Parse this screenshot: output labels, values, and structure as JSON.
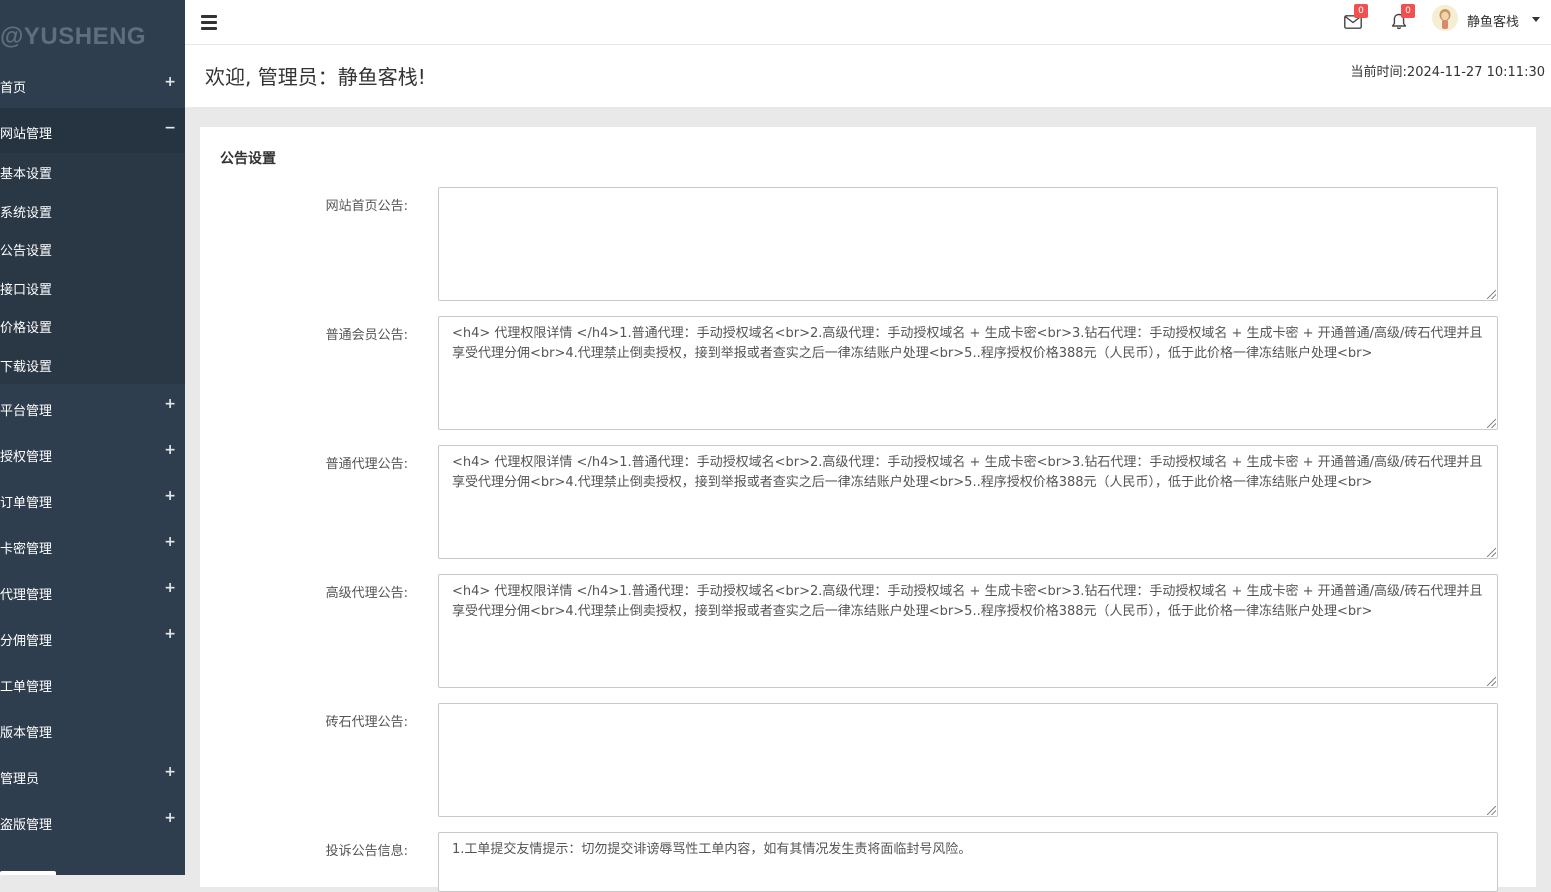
{
  "sidebar": {
    "logo": "@YUSHENG",
    "items": [
      {
        "label": "首页",
        "toggle": "+"
      },
      {
        "label": "网站管理",
        "toggle": "−"
      },
      {
        "label": "平台管理",
        "toggle": "+"
      },
      {
        "label": "授权管理",
        "toggle": "+"
      },
      {
        "label": "订单管理",
        "toggle": "+"
      },
      {
        "label": "卡密管理",
        "toggle": "+"
      },
      {
        "label": "代理管理",
        "toggle": "+"
      },
      {
        "label": "分佣管理",
        "toggle": "+"
      },
      {
        "label": "工单管理",
        "toggle": ""
      },
      {
        "label": "版本管理",
        "toggle": ""
      },
      {
        "label": "管理员",
        "toggle": "+"
      },
      {
        "label": "盗版管理",
        "toggle": "+"
      }
    ],
    "submenu": [
      {
        "label": "基本设置"
      },
      {
        "label": "系统设置"
      },
      {
        "label": "公告设置"
      },
      {
        "label": "接口设置"
      },
      {
        "label": "价格设置"
      },
      {
        "label": "下载设置"
      }
    ]
  },
  "header": {
    "mail_count": "0",
    "bell_count": "0",
    "user_name": "静鱼客栈"
  },
  "welcome": {
    "text": "欢迎, 管理员：静鱼客栈!",
    "time": "当前时间:2024-11-27 10:11:30"
  },
  "panel": {
    "title": "公告设置",
    "fields": [
      {
        "label": "网站首页公告:",
        "value": ""
      },
      {
        "label": "普通会员公告:",
        "value": "<h4> 代理权限详情 </h4>1.普通代理：手动授权域名<br>2.高级代理：手动授权域名 + 生成卡密<br>3.钻石代理：手动授权域名 + 生成卡密 + 开通普通/高级/砖石代理并且享受代理分佣<br>4.代理禁止倒卖授权，接到举报或者查实之后一律冻结账户处理<br>5..程序授权价格388元（人民币），低于此价格一律冻结账户处理<br>"
      },
      {
        "label": "普通代理公告:",
        "value": "<h4> 代理权限详情 </h4>1.普通代理：手动授权域名<br>2.高级代理：手动授权域名 + 生成卡密<br>3.钻石代理：手动授权域名 + 生成卡密 + 开通普通/高级/砖石代理并且享受代理分佣<br>4.代理禁止倒卖授权，接到举报或者查实之后一律冻结账户处理<br>5..程序授权价格388元（人民币），低于此价格一律冻结账户处理<br>"
      },
      {
        "label": "高级代理公告:",
        "value": "<h4> 代理权限详情 </h4>1.普通代理：手动授权域名<br>2.高级代理：手动授权域名 + 生成卡密<br>3.钻石代理：手动授权域名 + 生成卡密 + 开通普通/高级/砖石代理并且享受代理分佣<br>4.代理禁止倒卖授权，接到举报或者查实之后一律冻结账户处理<br>5..程序授权价格388元（人民币），低于此价格一律冻结账户处理<br>"
      },
      {
        "label": "砖石代理公告:",
        "value": ""
      },
      {
        "label": "投诉公告信息:",
        "value": "1.工单提交友情提示：切勿提交诽谤辱骂性工单内容，如有其情况发生责将面临封号风险。"
      }
    ]
  },
  "colors": {
    "sidebar_bg": "#2f3e4e",
    "badge": "#f0504f"
  }
}
